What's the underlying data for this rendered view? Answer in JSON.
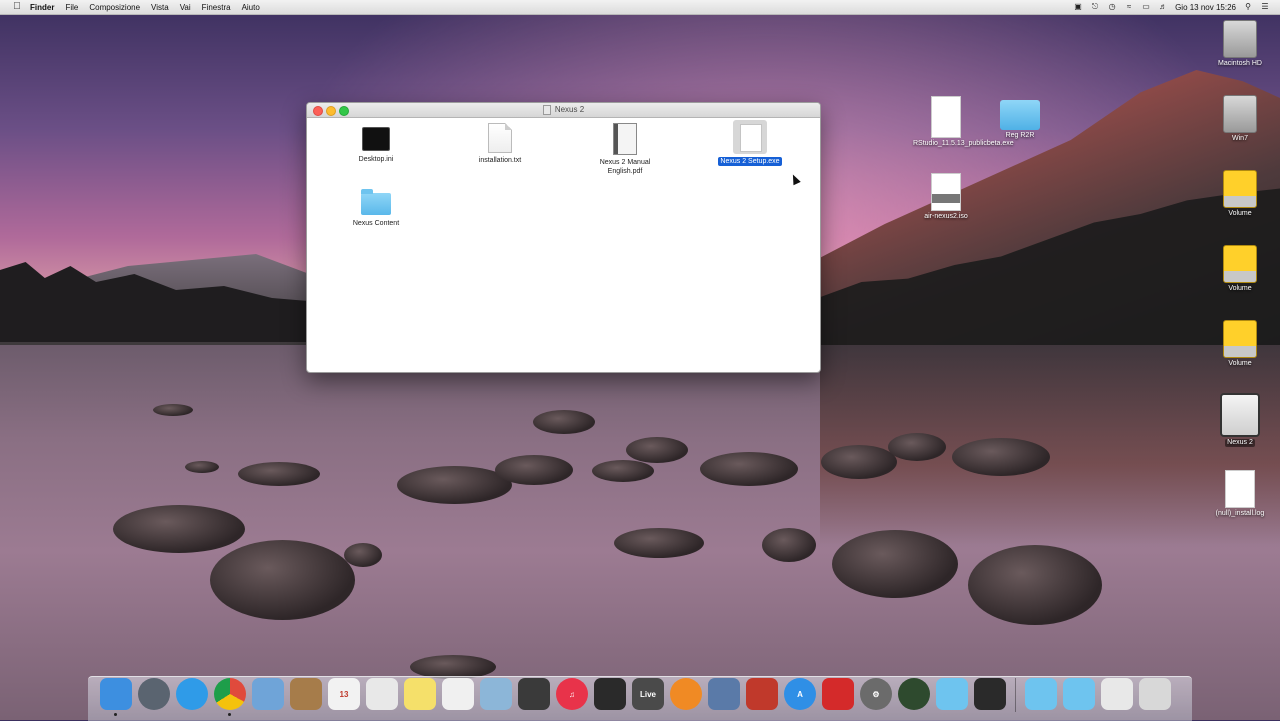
{
  "menubar": {
    "app_name": "Finder",
    "menus": [
      "File",
      "Composizione",
      "Vista",
      "Vai",
      "Finestra",
      "Aiuto"
    ],
    "datetime": "Gio 13 nov  15:26"
  },
  "window": {
    "title": "Nexus 2",
    "files": [
      {
        "label": "Desktop.ini",
        "icon": "terminal-icon"
      },
      {
        "label": "installation.txt",
        "icon": "text-document-icon"
      },
      {
        "label": "Nexus 2 Manual English.pdf",
        "icon": "pdf-document-icon"
      },
      {
        "label": "Nexus 2 Setup.exe",
        "icon": "exe-file-icon",
        "selected": true
      },
      {
        "label": "Nexus Content",
        "icon": "folder-icon"
      }
    ]
  },
  "desktop": {
    "icons": [
      {
        "label": "Macintosh HD",
        "icon": "hard-drive-icon"
      },
      {
        "label": "Win7",
        "icon": "hard-drive-icon"
      },
      {
        "label": "Volume",
        "icon": "external-volume-icon"
      },
      {
        "label": "Volume",
        "icon": "external-volume-icon"
      },
      {
        "label": "Volume",
        "icon": "external-volume-icon"
      },
      {
        "label": "Nexus 2",
        "icon": "disk-image-icon"
      },
      {
        "label": "(null)_install.log",
        "icon": "log-document-icon"
      },
      {
        "label": "RStudio_11.5.13_publicbeta.exe",
        "icon": "document-icon"
      },
      {
        "label": "Reg R2R",
        "icon": "folder-icon"
      },
      {
        "label": "air-nexus2.iso",
        "icon": "iso-document-icon"
      }
    ]
  },
  "dock": {
    "live_label": "Live",
    "items": [
      {
        "name": "finder",
        "color": "#3d8fe0"
      },
      {
        "name": "launchpad",
        "color": "#5a6470"
      },
      {
        "name": "safari",
        "color": "#2f9be8"
      },
      {
        "name": "chrome",
        "color": "#e04a3c"
      },
      {
        "name": "preview",
        "color": "#6fa4d8"
      },
      {
        "name": "contacts",
        "color": "#a67c4a"
      },
      {
        "name": "calendar",
        "color": "#f2f2f2"
      },
      {
        "name": "textedit",
        "color": "#e8e8e8"
      },
      {
        "name": "notes",
        "color": "#f5e06a"
      },
      {
        "name": "reminders",
        "color": "#f0f0f0"
      },
      {
        "name": "photos",
        "color": "#8cb6d8"
      },
      {
        "name": "final-cut",
        "color": "#3a3a3a"
      },
      {
        "name": "itunes",
        "color": "#e8334a"
      },
      {
        "name": "claquette",
        "color": "#2a2a2a"
      },
      {
        "name": "ableton-live",
        "color": "#4a4a4a"
      },
      {
        "name": "ibooks",
        "color": "#f08a24"
      },
      {
        "name": "imovie",
        "color": "#5a7aa8"
      },
      {
        "name": "toolkit",
        "color": "#c0392b"
      },
      {
        "name": "app-store",
        "color": "#2f8fe6"
      },
      {
        "name": "avira",
        "color": "#d42a2a"
      },
      {
        "name": "system-preferences",
        "color": "#6b6b6b"
      },
      {
        "name": "razer-synapse",
        "color": "#2e4a2e"
      },
      {
        "name": "folder",
        "color": "#6ec4ef"
      },
      {
        "name": "console",
        "color": "#2a2a2a"
      }
    ],
    "right_items": [
      {
        "name": "applications",
        "color": "#6ec4ef"
      },
      {
        "name": "downloads",
        "color": "#6ec4ef"
      },
      {
        "name": "screenshot",
        "color": "#e8e8e8"
      },
      {
        "name": "trash",
        "color": "#d8d8d8"
      }
    ]
  }
}
